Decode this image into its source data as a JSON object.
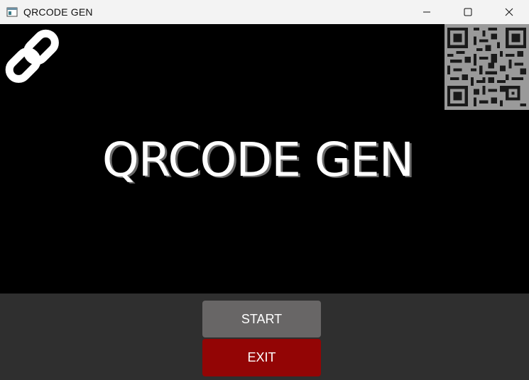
{
  "window": {
    "title": "QRCODE GEN",
    "controls": {
      "minimize": "minimize",
      "maximize": "maximize",
      "close": "close"
    }
  },
  "main": {
    "headline": "QRCODE GEN",
    "icons": {
      "left": "link-icon",
      "right": "qr-code-icon"
    }
  },
  "actions": {
    "start_label": "START",
    "exit_label": "EXIT"
  },
  "colors": {
    "background": "#000000",
    "footer": "#2f2f2f",
    "start_button": "#686666",
    "exit_button": "#930505",
    "titlebar": "#f3f3f3"
  }
}
